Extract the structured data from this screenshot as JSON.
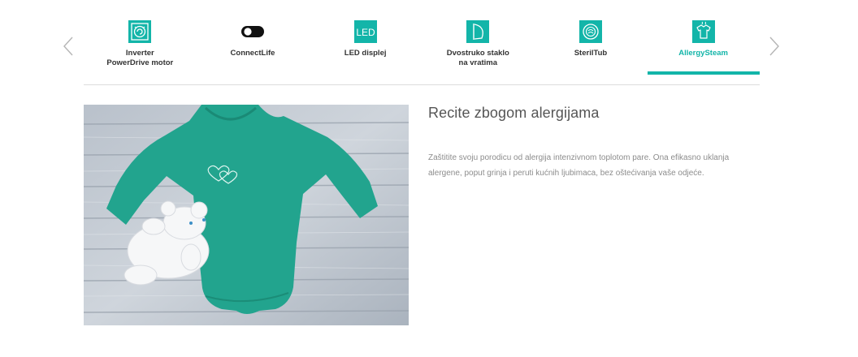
{
  "carousel": {
    "tabs": [
      {
        "label": "Inverter\nPowerDrive motor",
        "icon": "inverter-motor-icon"
      },
      {
        "label": "ConnectLife",
        "icon": "connectlife-toggle-icon"
      },
      {
        "label": "LED displej",
        "icon_text": "LED",
        "icon": "led-display-icon"
      },
      {
        "label": "Dvostruko staklo\nna vratima",
        "icon": "double-glass-door-icon"
      },
      {
        "label": "SterilTub",
        "icon": "steriltub-icon"
      },
      {
        "label": "AllergySteam",
        "icon": "allergysteam-icon"
      }
    ],
    "active_index": 5,
    "accent_color": "#13b5a9",
    "prev_icon": "chevron-left-icon",
    "next_icon": "chevron-right-icon"
  },
  "feature": {
    "title": "Recite zbogom alergijama",
    "description": "Zaštitite svoju porodicu od alergija intenzivnom toplotom pare. Ona efikasno uklanja alergene, poput grinja i peruti kućnih ljubimaca, bez oštećivanja vaše odjeće.",
    "image": "baby-bodysuit-photo"
  }
}
